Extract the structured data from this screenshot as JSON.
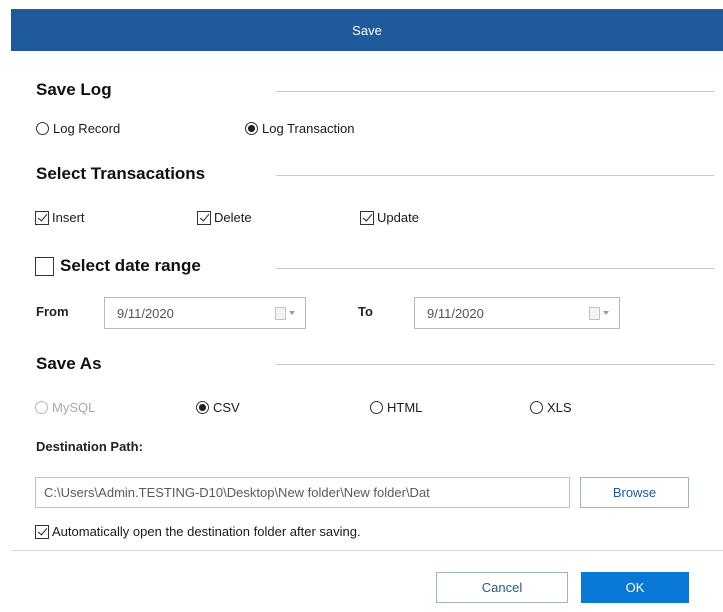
{
  "dialog": {
    "title": "Save"
  },
  "save_log": {
    "heading": "Save Log",
    "options": [
      {
        "label": "Log Record",
        "selected": false
      },
      {
        "label": "Log Transaction",
        "selected": true
      }
    ]
  },
  "transactions": {
    "heading": "Select Transacations",
    "items": [
      {
        "label": "Insert",
        "checked": true
      },
      {
        "label": "Delete",
        "checked": true
      },
      {
        "label": "Update",
        "checked": true
      }
    ]
  },
  "date_range": {
    "label": "Select date range",
    "checked": false,
    "from_label": "From",
    "from_value": "9/11/2020",
    "to_label": "To",
    "to_value": "9/11/2020"
  },
  "save_as": {
    "heading": "Save As",
    "options": [
      {
        "label": "MySQL",
        "selected": false,
        "disabled": true
      },
      {
        "label": "CSV",
        "selected": true,
        "disabled": false
      },
      {
        "label": "HTML",
        "selected": false,
        "disabled": false
      },
      {
        "label": "XLS",
        "selected": false,
        "disabled": false
      }
    ]
  },
  "destination": {
    "label": "Destination Path:",
    "value": "C:\\Users\\Admin.TESTING-D10\\Desktop\\New folder\\New folder\\Dat",
    "browse_label": "Browse"
  },
  "auto_open": {
    "label": "Automatically open the destination folder after saving.",
    "checked": true
  },
  "footer": {
    "cancel_label": "Cancel",
    "ok_label": "OK"
  },
  "colors": {
    "title_bar": "#1e5a9c",
    "primary": "#0a78d7"
  }
}
